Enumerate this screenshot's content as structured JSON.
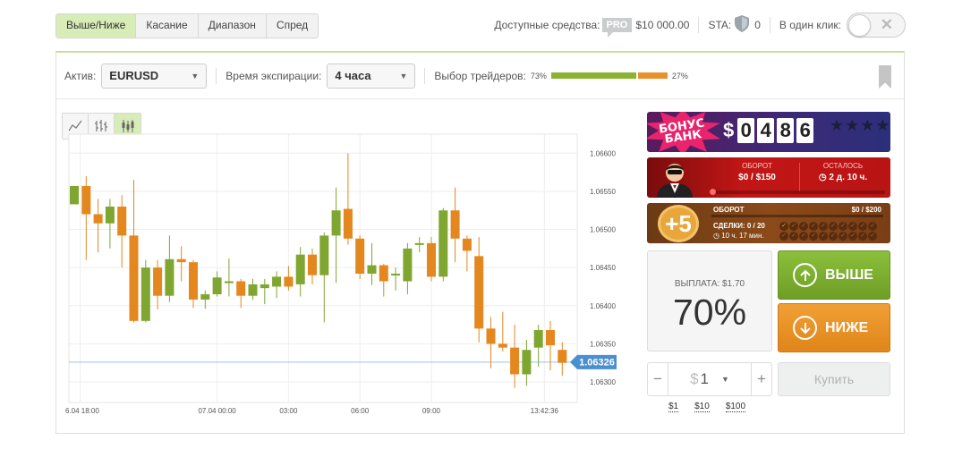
{
  "tabs": [
    {
      "label": "Выше/Ниже",
      "active": true
    },
    {
      "label": "Касание"
    },
    {
      "label": "Диапазон"
    },
    {
      "label": "Спред"
    }
  ],
  "header": {
    "funds_label": "Доступные средства:",
    "pro_badge": "PRO",
    "funds_value": "$10 000.00",
    "sta_label": "STA:",
    "sta_value": "0",
    "oneclick_label": "В один клик:"
  },
  "toolbar": {
    "asset_label": "Актив:",
    "asset_value": "EURUSD",
    "expiry_label": "Время экспирации:",
    "expiry_value": "4 часа",
    "traders_label": "Выбор трейдеров:",
    "traders_up_pct": "73%",
    "traders_down_pct": "27%",
    "traders_up_share": 0.73
  },
  "bonus": {
    "title_line1": "БОНУС",
    "title_line2": "БАНК",
    "currency": "$",
    "digits": [
      "0",
      "4",
      "8",
      "6"
    ],
    "stars": "★★★★★"
  },
  "banner2": {
    "turnover_label": "ОБОРОТ",
    "turnover_value": "$0 / $150",
    "remaining_label": "ОСТАЛОСЬ",
    "remaining_value": "2 д. 10 ч."
  },
  "banner3": {
    "badge": "+5",
    "turnover_label": "ОБОРОТ",
    "turnover_value": "$0 / $200",
    "deals": "СДЕЛКИ: 0 / 20",
    "time": "10 ч. 17 мин."
  },
  "trade": {
    "payout_label": "ВЫПЛАТА: $1.70",
    "payout_pct": "70%",
    "up_label": "ВЫШЕ",
    "down_label": "НИЖЕ",
    "amount_currency": "$",
    "amount_value": "1",
    "minus": "−",
    "plus": "+",
    "buy_label": "Купить",
    "quick_amounts": [
      "$1",
      "$10",
      "$100"
    ]
  },
  "chart_data": {
    "type": "candlestick",
    "y_ticks": [
      "1.06600",
      "1.06550",
      "1.06500",
      "1.06450",
      "1.06400",
      "1.06350",
      "1.06300"
    ],
    "ylim": [
      1.06273,
      1.06625
    ],
    "x_ticks": [
      {
        "label": "06.04 18:00",
        "i": 0.5
      },
      {
        "label": "07.04 00:00",
        "i": 12
      },
      {
        "label": "03:00",
        "i": 18
      },
      {
        "label": "06:00",
        "i": 24
      },
      {
        "label": "09:00",
        "i": 30
      },
      {
        "label": "13:42:36",
        "i": 39.5
      }
    ],
    "current_price": "1.06326",
    "current_value": 1.06326,
    "up_color": "#7fa630",
    "down_color": "#e3871e",
    "candles": [
      {
        "o": 1.06533,
        "c": 1.06557,
        "h": 1.06557,
        "l": 1.06533
      },
      {
        "o": 1.06557,
        "c": 1.0652,
        "h": 1.0657,
        "l": 1.0646
      },
      {
        "o": 1.0652,
        "c": 1.06508,
        "h": 1.0654,
        "l": 1.0647
      },
      {
        "o": 1.06508,
        "c": 1.0653,
        "h": 1.0654,
        "l": 1.06475
      },
      {
        "o": 1.0653,
        "c": 1.06492,
        "h": 1.06545,
        "l": 1.0645
      },
      {
        "o": 1.06492,
        "c": 1.0638,
        "h": 1.06565,
        "l": 1.06378
      },
      {
        "o": 1.0638,
        "c": 1.0645,
        "h": 1.0646,
        "l": 1.06378
      },
      {
        "o": 1.0645,
        "c": 1.06413,
        "h": 1.0646,
        "l": 1.06395
      },
      {
        "o": 1.06413,
        "c": 1.06461,
        "h": 1.06492,
        "l": 1.06405
      },
      {
        "o": 1.06461,
        "c": 1.06457,
        "h": 1.06478,
        "l": 1.06432
      },
      {
        "o": 1.06457,
        "c": 1.06408,
        "h": 1.0646,
        "l": 1.06397
      },
      {
        "o": 1.06408,
        "c": 1.06415,
        "h": 1.0642,
        "l": 1.06396
      },
      {
        "o": 1.06415,
        "c": 1.06437,
        "h": 1.06445,
        "l": 1.06412
      },
      {
        "o": 1.0643,
        "c": 1.06432,
        "h": 1.06462,
        "l": 1.06412
      },
      {
        "o": 1.06432,
        "c": 1.06413,
        "h": 1.06435,
        "l": 1.06397
      },
      {
        "o": 1.06413,
        "c": 1.06428,
        "h": 1.06435,
        "l": 1.06408
      },
      {
        "o": 1.06423,
        "c": 1.06428,
        "h": 1.06435,
        "l": 1.06402
      },
      {
        "o": 1.06425,
        "c": 1.06438,
        "h": 1.06445,
        "l": 1.0641
      },
      {
        "o": 1.06438,
        "c": 1.06425,
        "h": 1.06452,
        "l": 1.0642
      },
      {
        "o": 1.06428,
        "c": 1.06467,
        "h": 1.06477,
        "l": 1.06412
      },
      {
        "o": 1.06467,
        "c": 1.0644,
        "h": 1.06475,
        "l": 1.06428
      },
      {
        "o": 1.0644,
        "c": 1.06492,
        "h": 1.06496,
        "l": 1.06378
      },
      {
        "o": 1.06492,
        "c": 1.06525,
        "h": 1.06555,
        "l": 1.0643
      },
      {
        "o": 1.06527,
        "c": 1.06488,
        "h": 1.066,
        "l": 1.0648
      },
      {
        "o": 1.06488,
        "c": 1.06442,
        "h": 1.06492,
        "l": 1.06435
      },
      {
        "o": 1.06442,
        "c": 1.06453,
        "h": 1.06482,
        "l": 1.06427
      },
      {
        "o": 1.06453,
        "c": 1.06432,
        "h": 1.06455,
        "l": 1.06412
      },
      {
        "o": 1.0644,
        "c": 1.06442,
        "h": 1.0645,
        "l": 1.0642
      },
      {
        "o": 1.06432,
        "c": 1.06475,
        "h": 1.06482,
        "l": 1.06415
      },
      {
        "o": 1.0648,
        "c": 1.06482,
        "h": 1.0649,
        "l": 1.0647
      },
      {
        "o": 1.06482,
        "c": 1.06438,
        "h": 1.0649,
        "l": 1.06432
      },
      {
        "o": 1.06438,
        "c": 1.06525,
        "h": 1.06528,
        "l": 1.06432
      },
      {
        "o": 1.06525,
        "c": 1.06488,
        "h": 1.06555,
        "l": 1.06457
      },
      {
        "o": 1.06488,
        "c": 1.06472,
        "h": 1.06492,
        "l": 1.06445
      },
      {
        "o": 1.06465,
        "c": 1.0637,
        "h": 1.0649,
        "l": 1.06352
      },
      {
        "o": 1.0637,
        "c": 1.0635,
        "h": 1.06385,
        "l": 1.06318
      },
      {
        "o": 1.0635,
        "c": 1.06345,
        "h": 1.06392,
        "l": 1.0634
      },
      {
        "o": 1.06345,
        "c": 1.0631,
        "h": 1.06375,
        "l": 1.06292
      },
      {
        "o": 1.0631,
        "c": 1.06342,
        "h": 1.06355,
        "l": 1.06295
      },
      {
        "o": 1.06345,
        "c": 1.06368,
        "h": 1.06375,
        "l": 1.0632
      },
      {
        "o": 1.06368,
        "c": 1.06348,
        "h": 1.0638,
        "l": 1.06315
      },
      {
        "o": 1.06342,
        "c": 1.06325,
        "h": 1.06352,
        "l": 1.06308
      }
    ]
  }
}
